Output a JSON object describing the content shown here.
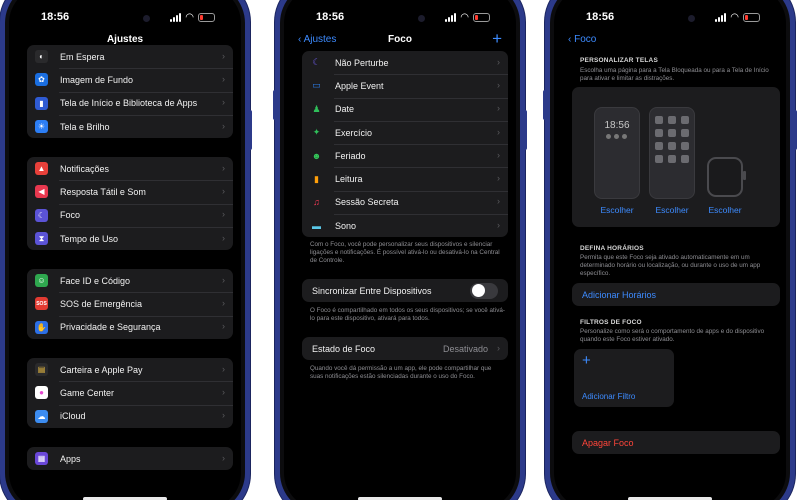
{
  "phone1": {
    "time": "18:56",
    "title": "Ajustes",
    "group1": [
      {
        "label": "Em Espera",
        "icon": "standby-icon",
        "color": "#2a2a2c",
        "glyph": "◐"
      },
      {
        "label": "Imagem de Fundo",
        "icon": "wallpaper-icon",
        "color": "#1a6ee0",
        "glyph": "✿"
      },
      {
        "label": "Tela de Início e Biblioteca de Apps",
        "icon": "home-screen-icon",
        "color": "#2f5bd3",
        "glyph": "▮"
      },
      {
        "label": "Tela e Brilho",
        "icon": "brightness-icon",
        "color": "#2c7ef5",
        "glyph": "☀"
      }
    ],
    "group2": [
      {
        "label": "Notificações",
        "icon": "notifications-icon",
        "color": "#e8403a",
        "glyph": "▲"
      },
      {
        "label": "Resposta Tátil e Som",
        "icon": "sound-icon",
        "color": "#e8384f",
        "glyph": "◀"
      },
      {
        "label": "Foco",
        "icon": "focus-moon-icon",
        "color": "#5b53d6",
        "glyph": "☾"
      },
      {
        "label": "Tempo de Uso",
        "icon": "screen-time-icon",
        "color": "#5b53d6",
        "glyph": "⧗"
      }
    ],
    "group3": [
      {
        "label": "Face ID e Código",
        "icon": "face-id-icon",
        "color": "#2fa84f",
        "glyph": "☺"
      },
      {
        "label": "SOS de Emergência",
        "icon": "sos-icon",
        "color": "#e23b32",
        "glyph": "SOS"
      },
      {
        "label": "Privacidade e Segurança",
        "icon": "privacy-hand-icon",
        "color": "#2c6fe5",
        "glyph": "✋"
      }
    ],
    "group4": [
      {
        "label": "Carteira e Apple Pay",
        "icon": "wallet-icon",
        "color": "#2a2a2c",
        "glyph": "▤"
      },
      {
        "label": "Game Center",
        "icon": "game-center-icon",
        "color": "#ffffff",
        "glyph": "●"
      },
      {
        "label": "iCloud",
        "icon": "icloud-icon",
        "color": "#3c8cf0",
        "glyph": "☁"
      }
    ],
    "group5": [
      {
        "label": "Apps",
        "icon": "apps-icon",
        "color": "#6a47d8",
        "glyph": "▦"
      }
    ]
  },
  "phone2": {
    "time": "18:56",
    "back": "Ajustes",
    "title": "Foco",
    "add": "+",
    "modes": [
      {
        "label": "Não Perturbe",
        "icon": "moon-icon",
        "color": "#6e5ce8",
        "glyph": "☾"
      },
      {
        "label": "Apple Event",
        "icon": "display-icon",
        "color": "#2d7ff0",
        "glyph": "▭"
      },
      {
        "label": "Date",
        "icon": "person-icon",
        "color": "#2fbf5a",
        "glyph": "♟"
      },
      {
        "label": "Exercício",
        "icon": "running-icon",
        "color": "#2fbf5a",
        "glyph": "✦"
      },
      {
        "label": "Feriado",
        "icon": "smile-icon",
        "color": "#33c759",
        "glyph": "☻"
      },
      {
        "label": "Leitura",
        "icon": "book-icon",
        "color": "#ff9f0a",
        "glyph": "▮"
      },
      {
        "label": "Sessão Secreta",
        "icon": "headphones-icon",
        "color": "#ff3b57",
        "glyph": "♫"
      },
      {
        "label": "Sono",
        "icon": "bed-icon",
        "color": "#5ac8e8",
        "glyph": "▬"
      }
    ],
    "modes_note": "Com o Foco, você pode personalizar seus dispositivos e silenciar ligações e notificações. É possível ativá-lo ou desativá-lo na Central de Controle.",
    "sync_label": "Sincronizar Entre Dispositivos",
    "sync_note": "O Foco é compartilhado em todos os seus dispositivos; se você ativá-lo para este dispositivo, ativará para todos.",
    "status_label": "Estado de Foco",
    "status_value": "Desativado",
    "status_note": "Quando você dá permissão a um app, ele pode compartilhar que suas notificações estão silenciadas durante o uso do Foco."
  },
  "phone3": {
    "time": "18:56",
    "back": "Foco",
    "customize_header": "PERSONALIZAR TELAS",
    "customize_desc": "Escolha uma página para a Tela Bloqueada ou para a Tela de Início para ativar e limitar as distrações.",
    "lock_time": "18:56",
    "choose": "Escolher",
    "schedule_header": "DEFINA HORÁRIOS",
    "schedule_desc": "Permita que este Foco seja ativado automaticamente em um determinado horário ou localização, ou durante o uso de um app específico.",
    "add_schedule": "Adicionar Horários",
    "filters_header": "FILTROS DE FOCO",
    "filters_desc": "Personalize como será o comportamento de apps e do dispositivo quando este Foco estiver ativado.",
    "add_filter_plus": "+",
    "add_filter": "Adicionar Filtro",
    "delete": "Apagar Foco"
  }
}
